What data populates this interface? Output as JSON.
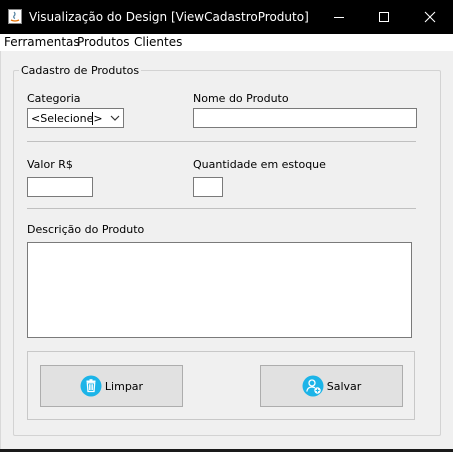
{
  "window": {
    "title": "Visualização do Design [ViewCadastroProduto]",
    "controls": {
      "minimize": "minimize-icon",
      "maximize": "maximize-icon",
      "close": "close-icon"
    }
  },
  "menu": {
    "items": [
      {
        "label": "Ferramentas"
      },
      {
        "label": "Produtos"
      },
      {
        "label": "Clientes"
      }
    ]
  },
  "form": {
    "group_title": "Cadastro de Produtos",
    "categoria": {
      "label": "Categoria",
      "selected": "<Selecione>"
    },
    "nome": {
      "label": "Nome do Produto",
      "value": ""
    },
    "valor": {
      "label": "Valor R$",
      "value": ""
    },
    "quantidade": {
      "label": "Quantidade em estoque",
      "value": ""
    },
    "descricao": {
      "label": "Descrição do Produto",
      "value": ""
    }
  },
  "buttons": {
    "limpar": {
      "label": "Limpar",
      "icon": "trash-icon",
      "color": "#1cb4e8"
    },
    "salvar": {
      "label": "Salvar",
      "icon": "add-user-icon",
      "color": "#1cb4e8"
    }
  }
}
